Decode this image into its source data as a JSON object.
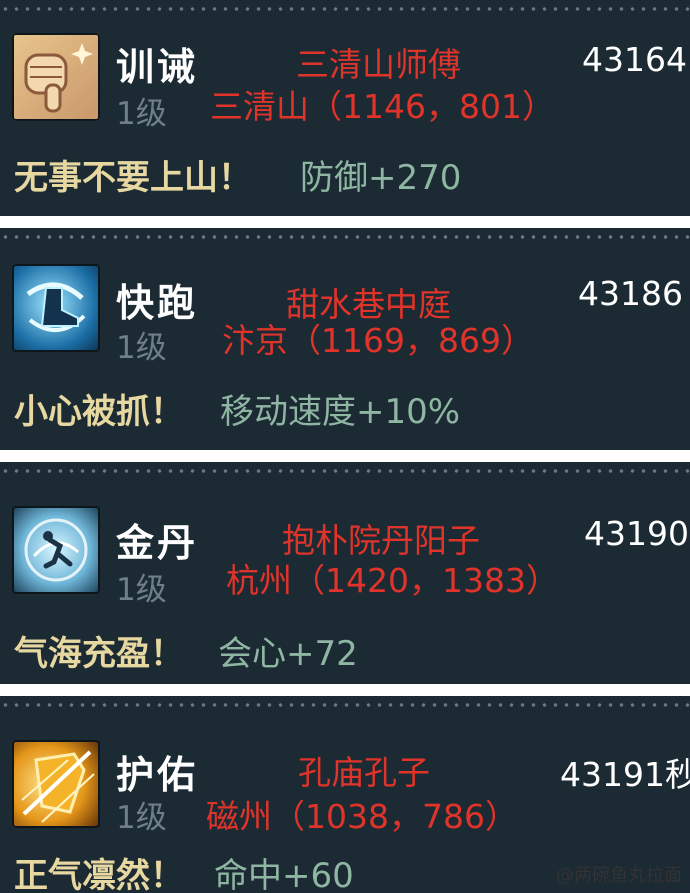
{
  "cards": [
    {
      "name": "训诫",
      "level": "1级",
      "location_title": "三清山师傅",
      "location_coords": "三清山（1146，801）",
      "time": "43164",
      "description": "无事不要上山！",
      "effect": "防御+270",
      "icon": "thumbs-down-icon"
    },
    {
      "name": "快跑",
      "level": "1级",
      "location_title": "甜水巷中庭",
      "location_coords": "汴京（1169，869）",
      "time": "43186",
      "description": "小心被抓！",
      "effect": "移动速度+10%",
      "icon": "running-shoe-icon"
    },
    {
      "name": "金丹",
      "level": "1级",
      "location_title": "抱朴院丹阳子",
      "location_coords": "杭州（1420，1383）",
      "time": "43190",
      "description": "气海充盈！",
      "effect": "会心+72",
      "icon": "qi-sphere-icon"
    },
    {
      "name": "护佑",
      "level": "1级",
      "location_title": "孔庙孔子",
      "location_coords": "磁州（1038，786）",
      "time": "43191秒",
      "description": "正气凛然！",
      "effect": "命中+60",
      "icon": "shield-icon"
    }
  ],
  "watermark": "@两碗鱼丸拉面"
}
